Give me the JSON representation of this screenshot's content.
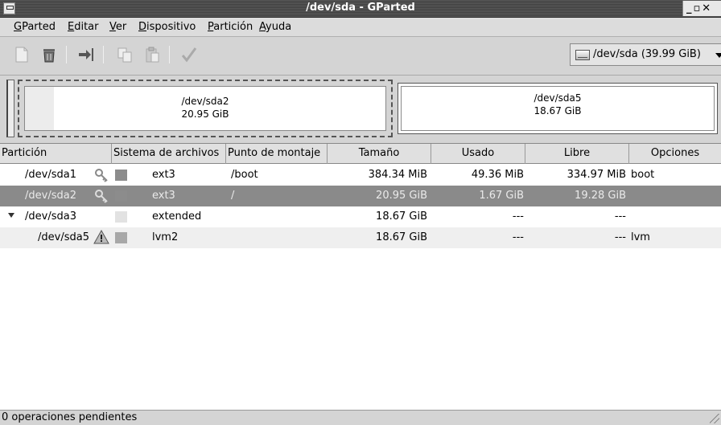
{
  "window": {
    "title": "/dev/sda - GParted",
    "controls": "_▫✕"
  },
  "menu": [
    {
      "label": "GParted",
      "mnemonic": "G",
      "rest": "Parted"
    },
    {
      "label": "Editar",
      "mnemonic": "E",
      "rest": "ditar"
    },
    {
      "label": "Ver",
      "mnemonic": "V",
      "rest": "er"
    },
    {
      "label": "Dispositivo",
      "mnemonic": "D",
      "rest": "ispositivo"
    },
    {
      "label": "Partición",
      "mnemonic": "P",
      "rest": "artición"
    },
    {
      "label": "Ayuda",
      "mnemonic": "A",
      "rest": "yuda"
    }
  ],
  "toolbar": {
    "device": "/dev/sda  (39.99 GiB)"
  },
  "diskmap": {
    "sda2": {
      "name": "/dev/sda2",
      "size": "20.95 GiB"
    },
    "sda5": {
      "name": "/dev/sda5",
      "size": "18.67 GiB"
    }
  },
  "table": {
    "headers": [
      "Partición",
      "Sistema de archivos",
      "Punto de montaje",
      "Tamaño",
      "Usado",
      "Libre",
      "Opciones"
    ],
    "rows": [
      {
        "partition": "/dev/sda1",
        "filesystem": "ext3",
        "mount": "/boot",
        "size": "384.34 MiB",
        "used": "49.36 MiB",
        "free": "334.97 MiB",
        "flags": "boot",
        "fs_color": "#8c8c8c"
      },
      {
        "partition": "/dev/sda2",
        "filesystem": "ext3",
        "mount": "/",
        "size": "20.95 GiB",
        "used": "1.67 GiB",
        "free": "19.28 GiB",
        "flags": "",
        "fs_color": "#8c8c8c"
      },
      {
        "partition": "/dev/sda3",
        "filesystem": "extended",
        "mount": "",
        "size": "18.67 GiB",
        "used": "---",
        "free": "---",
        "flags": "",
        "fs_color": "#e2e2e2"
      },
      {
        "partition": "/dev/sda5",
        "filesystem": "lvm2",
        "mount": "",
        "size": "18.67 GiB",
        "used": "---",
        "free": "---",
        "flags": "lvm",
        "fs_color": "#a8a8a8"
      }
    ]
  },
  "status": {
    "text": "0 operaciones pendientes"
  }
}
